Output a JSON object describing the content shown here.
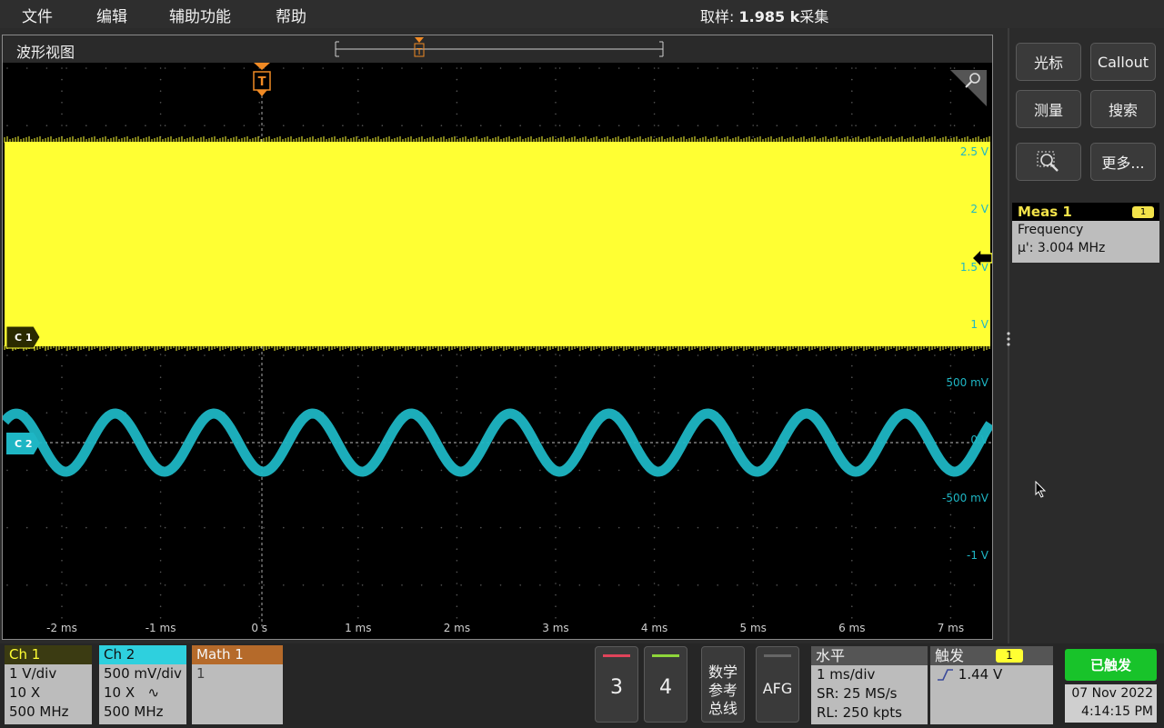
{
  "menu": [
    "文件",
    "编辑",
    "辅助功能",
    "帮助"
  ],
  "acquisition": {
    "prefix": "取样: ",
    "value": "1.985 k",
    "suffix": "采集"
  },
  "waveform_view": {
    "title": "波形视图",
    "trigger_marker": "T",
    "ch1_label": "C 1",
    "ch2_label": "C 2",
    "ch1_scale_labels": [
      "2.5 V",
      "2 V",
      "1.5 V",
      "1 V"
    ],
    "ch2_scale_labels": [
      "500 mV",
      "0 V",
      "-500 mV",
      "-1 V"
    ],
    "time_labels": [
      "-2 ms",
      "-1 ms",
      "0 s",
      "1 ms",
      "2 ms",
      "3 ms",
      "4 ms",
      "5 ms",
      "6 ms",
      "7 ms"
    ],
    "colors": {
      "ch1": "#ffff33",
      "ch2": "#1eb6c4",
      "trigger": "#f08a24"
    },
    "ch2_cycles": 10
  },
  "side_panel": {
    "buttons": [
      "光标",
      "Callout",
      "测量",
      "搜索",
      "zoom-icon",
      "更多..."
    ],
    "meas": {
      "title": "Meas 1",
      "badge": "1",
      "name": "Frequency",
      "value": "μ': 3.004 MHz"
    }
  },
  "channels": [
    {
      "name": "Ch 1",
      "scale": "1 V/div",
      "probe": "10 X",
      "bw": "500 MHz",
      "color": "#ffff33"
    },
    {
      "name": "Ch 2",
      "scale": "500 mV/div",
      "probe": "10 X",
      "coupling": "∿",
      "bw": "500 MHz",
      "color": "#2ed0de"
    },
    {
      "name": "Math 1",
      "value": "1",
      "color": "#b56a2a"
    }
  ],
  "buttons_bottom": {
    "b3": "3",
    "b4": "4",
    "bus_lines": [
      "数学",
      "参考",
      "总线"
    ],
    "afg": "AFG"
  },
  "horizontal": {
    "title": "水平",
    "scale": "1 ms/div",
    "sr": "SR: 25 MS/s",
    "rl": "RL: 250 kpts"
  },
  "trigger": {
    "title": "触发",
    "badge": "1",
    "level": "1.44 V"
  },
  "status": {
    "label": "已触发",
    "date": "07 Nov 2022",
    "time": "4:14:15 PM"
  }
}
